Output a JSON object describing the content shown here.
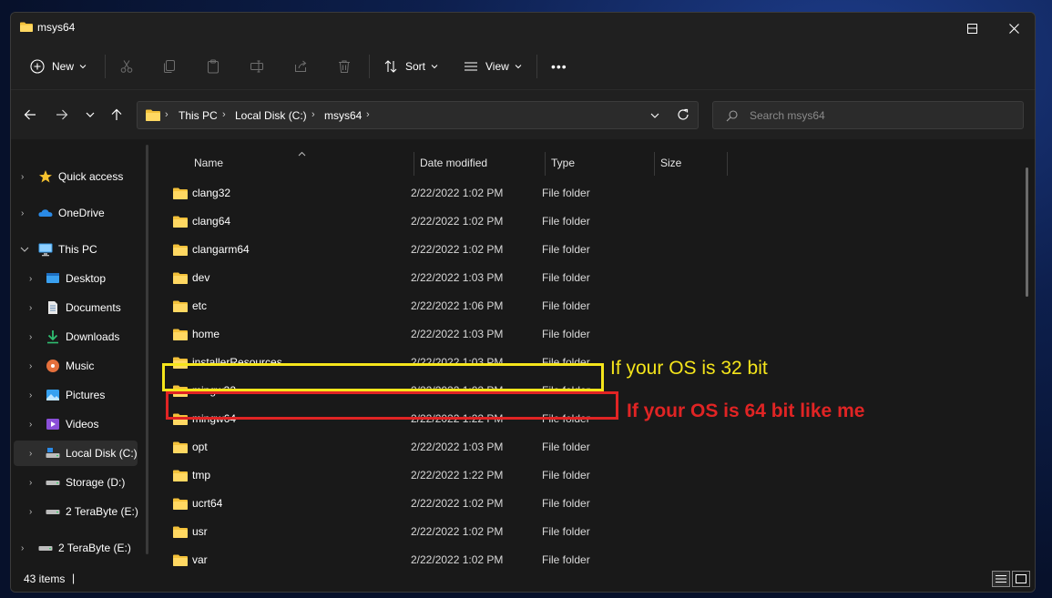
{
  "window": {
    "title": "msys64"
  },
  "toolbar": {
    "new_label": "New",
    "sort_label": "Sort",
    "view_label": "View",
    "more_label": "•••"
  },
  "address": {
    "crumbs": [
      "This PC",
      "Local Disk (C:)",
      "msys64"
    ],
    "search_placeholder": "Search msys64"
  },
  "sidebar": {
    "items": [
      {
        "label": "Quick access",
        "icon": "star-icon"
      },
      {
        "label": "OneDrive",
        "icon": "cloud-icon"
      },
      {
        "label": "This PC",
        "icon": "monitor-icon"
      },
      {
        "label": "Desktop",
        "icon": "desktop-folder-icon"
      },
      {
        "label": "Documents",
        "icon": "documents-icon"
      },
      {
        "label": "Downloads",
        "icon": "download-icon"
      },
      {
        "label": "Music",
        "icon": "music-icon"
      },
      {
        "label": "Pictures",
        "icon": "pictures-icon"
      },
      {
        "label": "Videos",
        "icon": "videos-icon"
      },
      {
        "label": "Local Disk (C:)",
        "icon": "drive-c-icon"
      },
      {
        "label": "Storage (D:)",
        "icon": "drive-icon"
      },
      {
        "label": "2 TeraByte (E:)",
        "icon": "drive-icon"
      },
      {
        "label": "2 TeraByte (E:)",
        "icon": "drive-icon"
      }
    ]
  },
  "columns": {
    "name": "Name",
    "date": "Date modified",
    "type": "Type",
    "size": "Size"
  },
  "files": [
    {
      "name": "clang32",
      "date": "2/22/2022 1:02 PM",
      "type": "File folder"
    },
    {
      "name": "clang64",
      "date": "2/22/2022 1:02 PM",
      "type": "File folder"
    },
    {
      "name": "clangarm64",
      "date": "2/22/2022 1:02 PM",
      "type": "File folder"
    },
    {
      "name": "dev",
      "date": "2/22/2022 1:03 PM",
      "type": "File folder"
    },
    {
      "name": "etc",
      "date": "2/22/2022 1:06 PM",
      "type": "File folder"
    },
    {
      "name": "home",
      "date": "2/22/2022 1:03 PM",
      "type": "File folder"
    },
    {
      "name": "installerResources",
      "date": "2/22/2022 1:03 PM",
      "type": "File folder"
    },
    {
      "name": "mingw32",
      "date": "2/22/2022 1:02 PM",
      "type": "File folder"
    },
    {
      "name": "mingw64",
      "date": "2/22/2022 1:22 PM",
      "type": "File folder"
    },
    {
      "name": "opt",
      "date": "2/22/2022 1:03 PM",
      "type": "File folder"
    },
    {
      "name": "tmp",
      "date": "2/22/2022 1:22 PM",
      "type": "File folder"
    },
    {
      "name": "ucrt64",
      "date": "2/22/2022 1:02 PM",
      "type": "File folder"
    },
    {
      "name": "usr",
      "date": "2/22/2022 1:02 PM",
      "type": "File folder"
    },
    {
      "name": "var",
      "date": "2/22/2022 1:02 PM",
      "type": "File folder"
    }
  ],
  "status": {
    "item_count": "43 items",
    "caret": "|"
  },
  "annotations": {
    "yellow_text": "If your OS is 32 bit",
    "red_text": "If your OS is 64 bit like me",
    "yellow_color": "#f5e51b",
    "red_color": "#e02424"
  }
}
